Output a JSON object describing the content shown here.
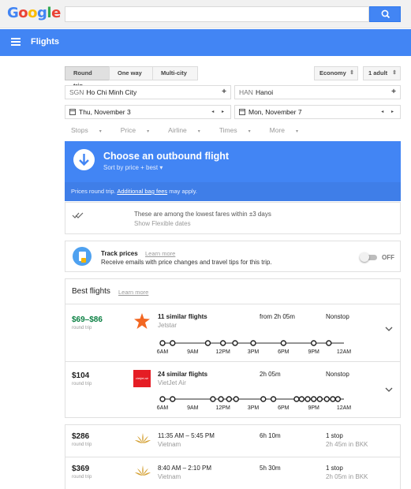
{
  "header": {
    "logo_letters": [
      {
        "ch": "G",
        "color": "#4285f4"
      },
      {
        "ch": "o",
        "color": "#ea4335"
      },
      {
        "ch": "o",
        "color": "#fbbc05"
      },
      {
        "ch": "g",
        "color": "#4285f4"
      },
      {
        "ch": "l",
        "color": "#34a853"
      },
      {
        "ch": "e",
        "color": "#ea4335"
      }
    ],
    "search_icon": "search-icon"
  },
  "appbar": {
    "title": "Flights",
    "menu_icon": "menu-icon"
  },
  "trip": {
    "tabs": [
      "Round trip",
      "One way",
      "Multi-city"
    ],
    "active_tab": "Round trip",
    "cabin": "Economy",
    "passengers": "1 adult",
    "origin_code": "SGN",
    "origin_city": "Ho Chi Minh City",
    "destination_code": "HAN",
    "destination_city": "Hanoi",
    "depart_date": "Thu, November 3",
    "return_date": "Mon, November 7",
    "plus": "+",
    "nav_arrows": "◂ ▸"
  },
  "filters": [
    "Stops",
    "Price",
    "Airline",
    "Times",
    "More"
  ],
  "outbound": {
    "title": "Choose an outbound flight",
    "subtitle": "Sort by price + best ▾",
    "note_prefix": "Prices round trip. ",
    "note_link": "Additional bag fees",
    "note_suffix": " may apply."
  },
  "info": {
    "line1": "These are among the lowest fares within ±3 days",
    "line2": "Show Flexible dates"
  },
  "track": {
    "title": "Track prices",
    "learn_more": "Learn more",
    "desc": "Receive emails with price changes and travel tips for this trip.",
    "toggle": "OFF"
  },
  "best": {
    "title": "Best flights",
    "learn_more": "Learn more",
    "time_ticks": [
      "6AM",
      "9AM",
      "12PM",
      "3PM",
      "6PM",
      "9PM",
      "12AM"
    ],
    "flights": [
      {
        "price": "$69–$86",
        "price_note": "round trip",
        "name": "11 similar flights",
        "airline": "Jetstar",
        "duration": "from 2h 05m",
        "stops": "Nonstop",
        "departures": [
          6.0,
          7.0,
          10.5,
          12.0,
          13.2,
          15.0,
          18.0,
          21.0,
          22.5
        ]
      },
      {
        "price": "$104",
        "price_note": "round trip",
        "name": "24 similar flights",
        "airline": "VietJet Air",
        "duration": "2h 05m",
        "stops": "Nonstop",
        "logo_text": "vietjet.air",
        "departures": [
          6.0,
          7.0,
          11.0,
          11.8,
          12.6,
          13.3,
          16.0,
          17.0,
          19.3,
          19.8,
          20.4,
          21.0,
          21.6,
          22.3,
          22.9,
          23.4
        ]
      }
    ]
  },
  "others": [
    {
      "price": "$286",
      "price_note": "round trip",
      "times": "11:35 AM – 5:45 PM",
      "airline": "Vietnam",
      "duration": "6h 10m",
      "stops": "1 stop",
      "layover": "2h 45m in BKK"
    },
    {
      "price": "$369",
      "price_note": "round trip",
      "times": "8:40 AM – 2:10 PM",
      "airline": "Vietnam",
      "duration": "5h 30m",
      "stops": "1 stop",
      "layover": "2h 05m in BKK"
    }
  ]
}
